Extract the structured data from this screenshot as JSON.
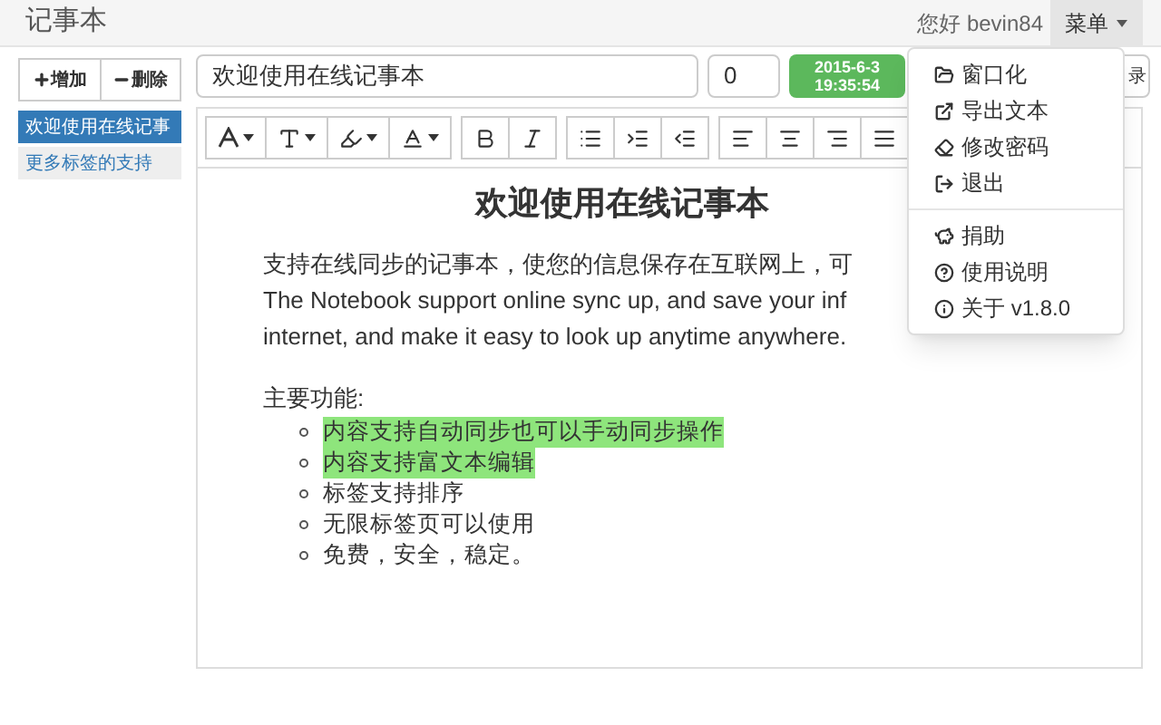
{
  "navbar": {
    "title": "记事本",
    "greeting": "您好 bevin84",
    "menu_button": {
      "label": "菜单",
      "expanded": true
    }
  },
  "sidebar": {
    "buttons": [
      {
        "kind": "plus",
        "label": "增加"
      },
      {
        "kind": "minus",
        "label": "删除"
      }
    ],
    "tags": [
      {
        "label": "欢迎使用在线记事",
        "selected": true
      },
      {
        "label": "更多标签的支持",
        "selected": false
      }
    ]
  },
  "note": {
    "title": "欢迎使用在线记事本",
    "count": "0",
    "date": "2015-6-3",
    "time": "19:35:54",
    "hidden_button": "录"
  },
  "toolbar": [
    [
      {
        "kind": "font"
      },
      {
        "kind": "size"
      },
      {
        "kind": "highlight"
      },
      {
        "kind": "color"
      }
    ],
    [
      {
        "kind": "bold"
      },
      {
        "kind": "italic"
      }
    ],
    [
      {
        "kind": "list"
      },
      {
        "kind": "indent"
      },
      {
        "kind": "outdent"
      }
    ],
    [
      {
        "kind": "left"
      },
      {
        "kind": "center"
      },
      {
        "kind": "right"
      },
      {
        "kind": "justify"
      }
    ]
  ],
  "content": {
    "heading": "欢迎使用在线记事本",
    "paragraph": [
      "支持在线同步的记事本，使您的信息保存在互联网上，可",
      "The Notebook support online sync up, and save your inf",
      "internet, and make it easy to look up anytime anywhere."
    ],
    "features_label": "主要功能:",
    "features": [
      {
        "text": "内容支持自动同步也可以手动同步操作",
        "highlighted": true
      },
      {
        "text": "内容支持富文本编辑",
        "highlighted": true
      },
      {
        "text": "标签支持排序",
        "highlighted": false
      },
      {
        "text": "无限标签页可以使用",
        "highlighted": false
      },
      {
        "text": "免费，安全，稳定。",
        "highlighted": false
      }
    ]
  },
  "menu": {
    "groups": [
      [
        {
          "kind": "folder",
          "label": "窗口化"
        },
        {
          "kind": "export",
          "label": "导出文本"
        },
        {
          "kind": "eraser",
          "label": "修改密码"
        },
        {
          "kind": "logout",
          "label": "退出"
        }
      ],
      [
        {
          "kind": "piggy",
          "label": "捐助"
        },
        {
          "kind": "help",
          "label": "使用说明"
        },
        {
          "kind": "info",
          "label": "关于 v1.8.0"
        }
      ]
    ]
  }
}
